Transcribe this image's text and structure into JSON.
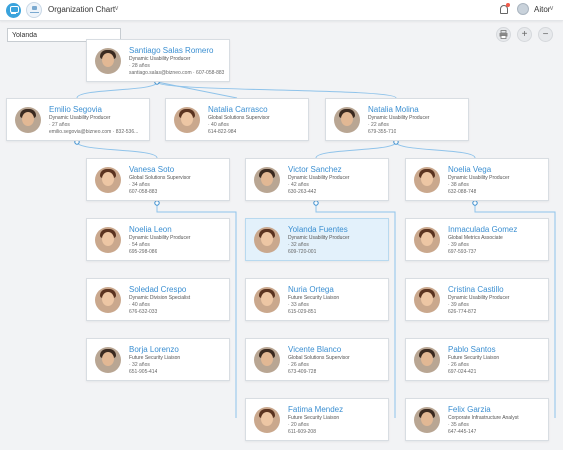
{
  "app": {
    "title": "Organization Chart",
    "user": "Aitor"
  },
  "search": {
    "value": "Yolanda"
  },
  "tools": {
    "zoom_in": "+",
    "zoom_out": "−"
  },
  "colors": {
    "accent": "#3b8fd1",
    "line": "#8fc3ea",
    "selected_bg": "#e3f1fb",
    "notification": "#f05a4a"
  },
  "cards": [
    {
      "name": "Santiago Salas Romero",
      "role": "Dynamic Usability Producer",
      "age": "· 28 años",
      "contact": "santiago.salas@bizneo.com · 607-058-883",
      "avatar": "avatar-male"
    },
    {
      "name": "Emilio Segovia",
      "role": "Dynamic Usability Producer",
      "age": "· 27 años",
      "contact": "emilio.segovia@bizneo.com · 832-536...",
      "avatar": "avatar-male"
    },
    {
      "name": "Natalia Carrasco",
      "role": "Global Solutions Supervisor",
      "age": "· 40 años",
      "contact": "614-822-984",
      "avatar": "avatar-female"
    },
    {
      "name": "Natalia Molina",
      "role": "Dynamic Usability Producer",
      "age": "· 22 años",
      "contact": "679-355-710",
      "avatar": "avatar-male"
    },
    {
      "name": "Vanesa Soto",
      "role": "Global Solutions Supervisor",
      "age": "· 34 años",
      "contact": "607-058-883",
      "avatar": "avatar-female"
    },
    {
      "name": "Victor Sanchez",
      "role": "Dynamic Usability Producer",
      "age": "· 42 años",
      "contact": "630-263-442",
      "avatar": "avatar-male"
    },
    {
      "name": "Noelia Vega",
      "role": "Dynamic Usability Producer",
      "age": "· 38 años",
      "contact": "632-088-748",
      "avatar": "avatar-female"
    },
    {
      "name": "Noelia Leon",
      "role": "Dynamic Usability Producer",
      "age": "· 54 años",
      "contact": "695-298-086",
      "avatar": "avatar-female"
    },
    {
      "name": "Yolanda Fuentes",
      "role": "Dynamic Usability Producer",
      "age": "· 32 años",
      "contact": "609-720-001",
      "avatar": "avatar-female",
      "selected": true
    },
    {
      "name": "Inmaculada Gomez",
      "role": "Global Metrics Associate",
      "age": "· 39 años",
      "contact": "697-593-737",
      "avatar": "avatar-female"
    },
    {
      "name": "Soledad Crespo",
      "role": "Dynamic Division Specialist",
      "age": "· 40 años",
      "contact": "676-632-033",
      "avatar": "avatar-female"
    },
    {
      "name": "Nuria Ortega",
      "role": "Future Security Liaison",
      "age": "· 33 años",
      "contact": "615-029-851",
      "avatar": "avatar-female"
    },
    {
      "name": "Cristina Castillo",
      "role": "Dynamic Usability Producer",
      "age": "· 39 años",
      "contact": "626-774-872",
      "avatar": "avatar-female"
    },
    {
      "name": "Borja Lorenzo",
      "role": "Future Security Liaison",
      "age": "· 32 años",
      "contact": "651-905-414",
      "avatar": "avatar-male"
    },
    {
      "name": "Vicente Blanco",
      "role": "Global Solutions Supervisor",
      "age": "· 26 años",
      "contact": "673-409-728",
      "avatar": "avatar-male"
    },
    {
      "name": "Pablo Santos",
      "role": "Future Security Liaison",
      "age": "· 26 años",
      "contact": "697-024-421",
      "avatar": "avatar-male"
    },
    {
      "name": "Fatima Mendez",
      "role": "Future Security Liaison",
      "age": "· 20 años",
      "contact": "611-609-208",
      "avatar": "avatar-female"
    },
    {
      "name": "Felix Garzia",
      "role": "Corporate Infrastructure Analyst",
      "age": "· 35 años",
      "contact": "647-445-147",
      "avatar": "avatar-male"
    }
  ]
}
